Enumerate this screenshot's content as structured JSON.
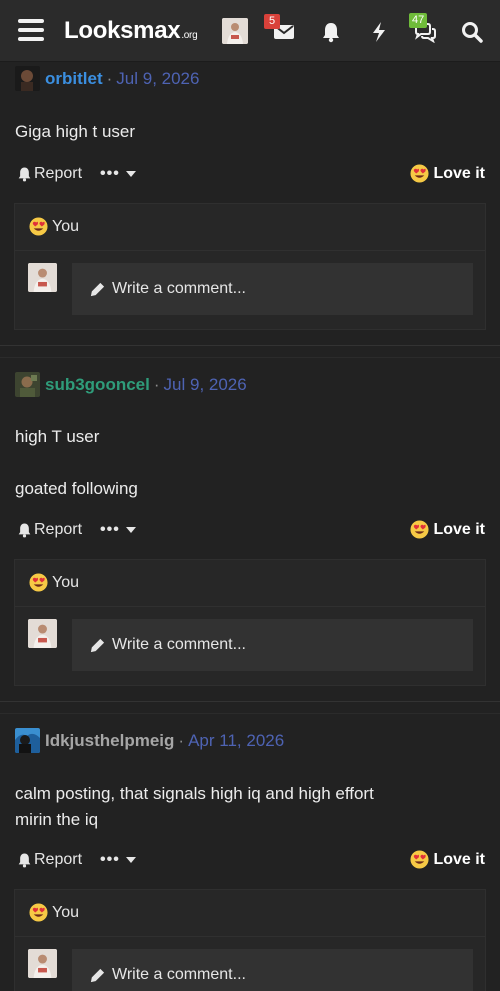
{
  "header": {
    "logo_text": "Looksmax",
    "logo_suffix": ".org",
    "inbox_badge": "5",
    "alerts_badge": "47",
    "icons": [
      "menu-icon",
      "avatar",
      "envelope-icon",
      "bell-icon",
      "lightning-icon",
      "chat-icon",
      "search-icon"
    ],
    "colors": {
      "badge_red": "#d9413a",
      "badge_green": "#6fbb3a",
      "bar": "#2b2b2b"
    }
  },
  "posts": [
    {
      "username": "orbitlet",
      "username_color": "#3b8fe0",
      "separator": "·",
      "date": "Jul 9, 2026",
      "body": "Giga high t user",
      "report_label": "Report",
      "more_label": "•••",
      "love_label": "Love it",
      "reaction_user": "You",
      "comment_placeholder": "Write a comment..."
    },
    {
      "username": "sub3gooncel",
      "username_color": "#2f9c7a",
      "separator": "·",
      "date": "Jul 9, 2026",
      "body": "high T user\n\ngoated following",
      "report_label": "Report",
      "more_label": "•••",
      "love_label": "Love it",
      "reaction_user": "You",
      "comment_placeholder": "Write a comment..."
    },
    {
      "username": "Idkjusthelpmeig",
      "username_color": "#a6a6a6",
      "separator": "·",
      "date": "Apr 11, 2026",
      "body": "calm posting, that signals high iq and high effort\nmirin the iq",
      "report_label": "Report",
      "more_label": "•••",
      "love_label": "Love it",
      "reaction_user": "You",
      "comment_placeholder": "Write a comment..."
    }
  ],
  "colors": {
    "date_link": "#4e63b3",
    "background": "#222222"
  }
}
